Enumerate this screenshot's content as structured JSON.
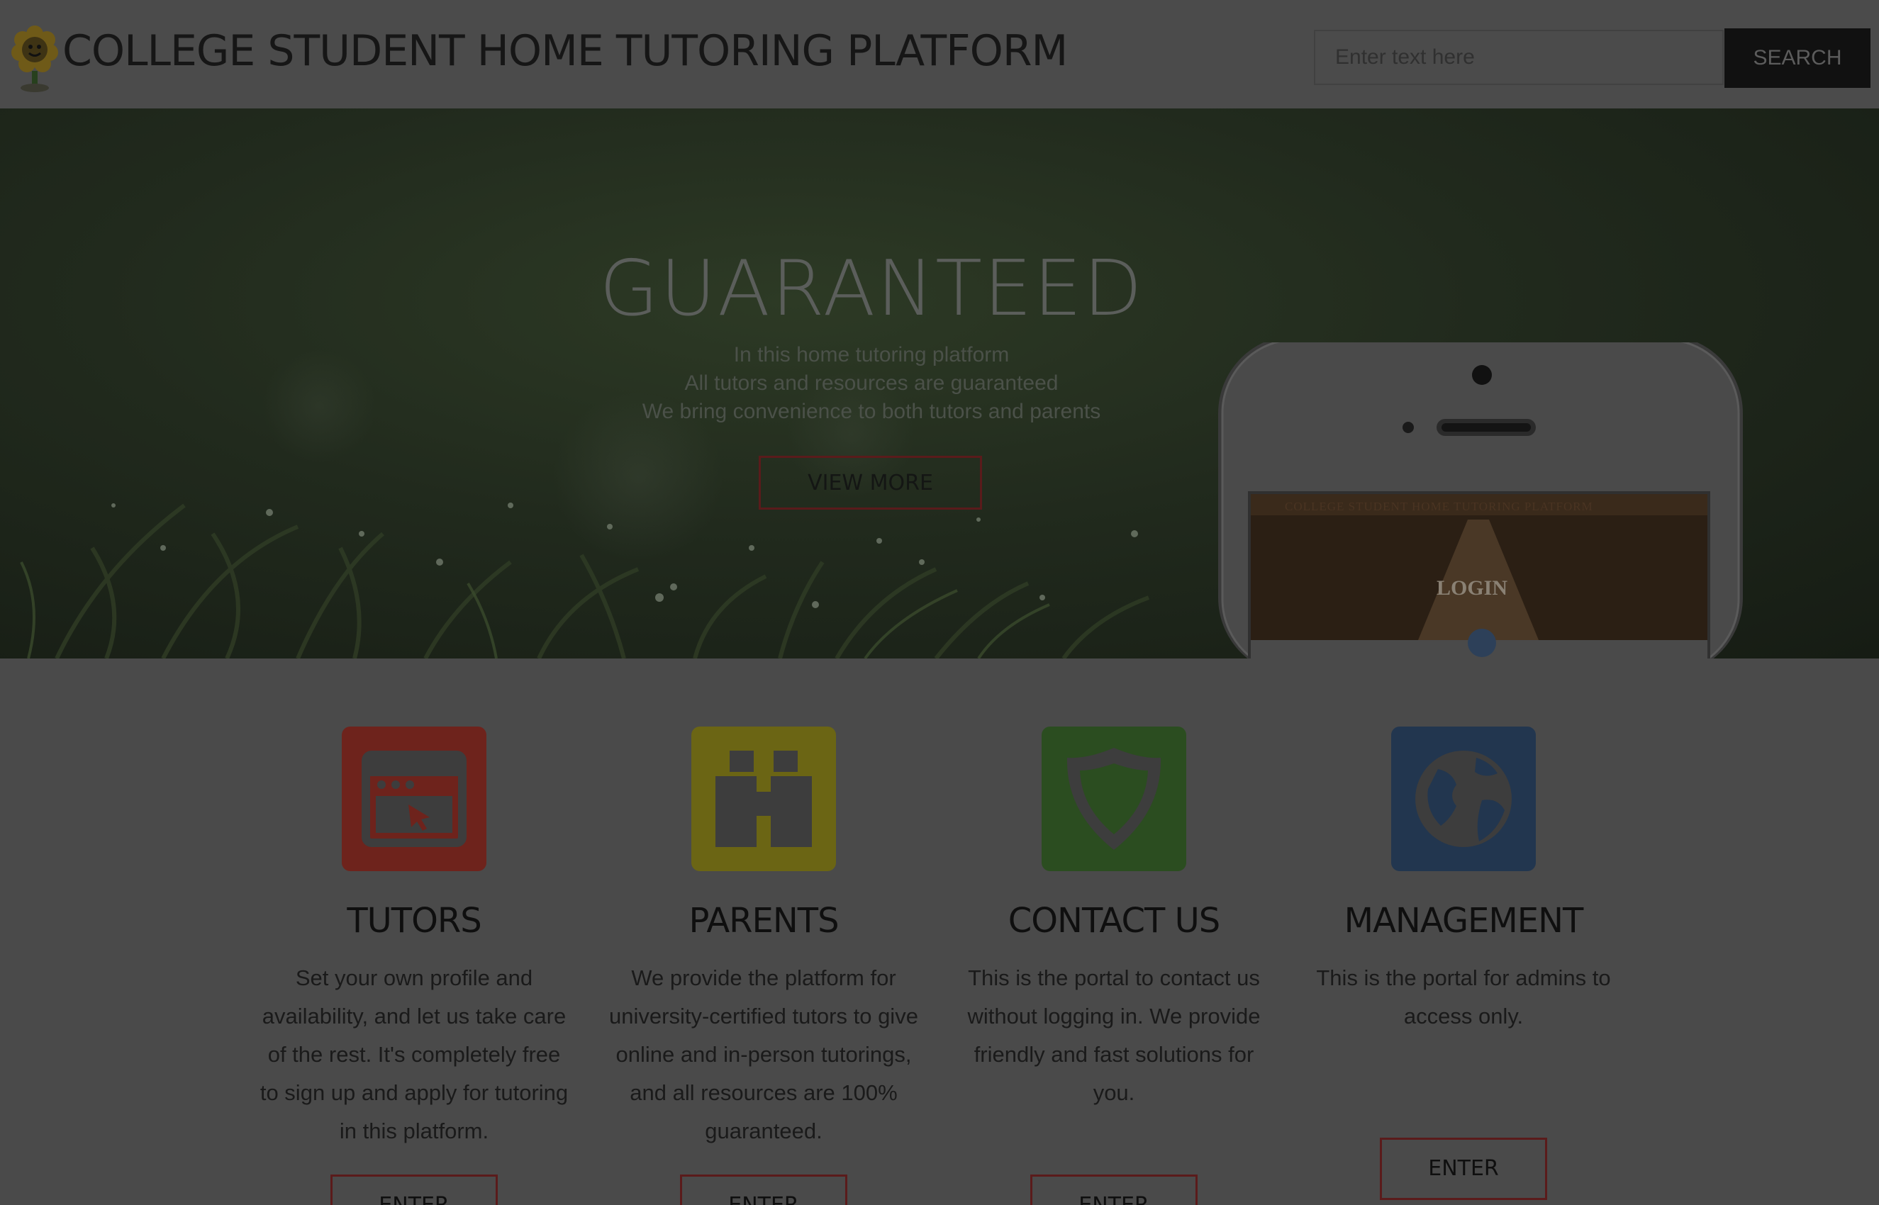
{
  "header": {
    "site_title": "COLLEGE STUDENT HOME TUTORING PLATFORM",
    "search_placeholder": "Enter text here",
    "search_label": "SEARCH"
  },
  "hero": {
    "title": "GUARANTEED",
    "lines": [
      "In this home tutoring platform",
      "All tutors and resources are guaranteed",
      "We bring convenience to both tutors and parents"
    ],
    "cta_label": "VIEW MORE",
    "phone_screen": {
      "banner_text": "COLLEGE STUDENT HOME TUTORING PLATFORM",
      "login_text": "LOGIN"
    }
  },
  "features": [
    {
      "title": "TUTORS",
      "icon": "browser-cursor-icon",
      "color": "#6e231c",
      "description": "Set your own profile and availability, and let us take care of the rest. It's completely free to sign up and apply for tutoring in this platform.",
      "button_label": "ENTER"
    },
    {
      "title": "PARENTS",
      "icon": "binoculars-icon",
      "color": "#6b6514",
      "description": "We provide the platform for university-certified tutors to give online and in-person tutorings, and all resources are 100% guaranteed.",
      "button_label": "ENTER"
    },
    {
      "title": "CONTACT US",
      "icon": "shield-icon",
      "color": "#2b4d20",
      "description": "This is the portal to contact us without logging in. We provide friendly and fast solutions for you.",
      "button_label": "ENTER"
    },
    {
      "title": "MANAGEMENT",
      "icon": "globe-icon",
      "color": "#22364f",
      "description": "This is the portal for admins to access only.",
      "button_label": "ENTER"
    }
  ]
}
